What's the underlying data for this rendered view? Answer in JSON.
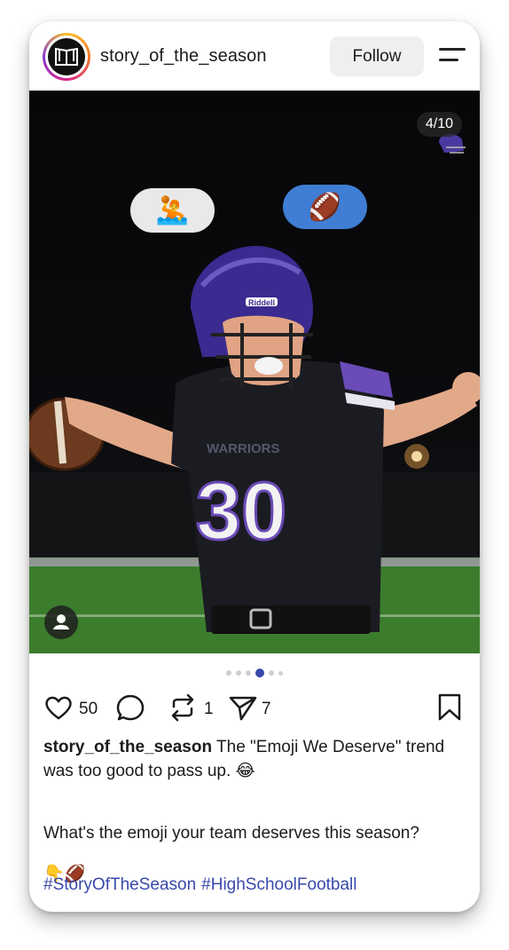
{
  "header": {
    "username": "story_of_the_season",
    "follow_label": "Follow"
  },
  "post": {
    "slide_counter": "4/10",
    "current_slide": 4,
    "total_slides": 10,
    "emoji_bubble_left": "🤽",
    "emoji_bubble_right": "🏈",
    "jersey_text": "WARRIORS",
    "jersey_number": "30",
    "helmet_brand": "Riddell"
  },
  "actions": {
    "likes": "50",
    "reposts": "1",
    "shares": "7"
  },
  "caption": {
    "username": "story_of_the_season",
    "text": "The \"Emoji We Deserve\" trend was too good to pass up. 😂",
    "question": "What's the emoji your team deserves this season?",
    "question_emoji": "👇🏈",
    "hashtags": [
      "#StoryOfTheSeason",
      "#HighSchoolFootball"
    ]
  },
  "colors": {
    "hashtag": "#3949ab",
    "bubble_right": "#3f7ed4",
    "bubble_left": "#e9e9e9",
    "active_dot": "#3949ab"
  }
}
